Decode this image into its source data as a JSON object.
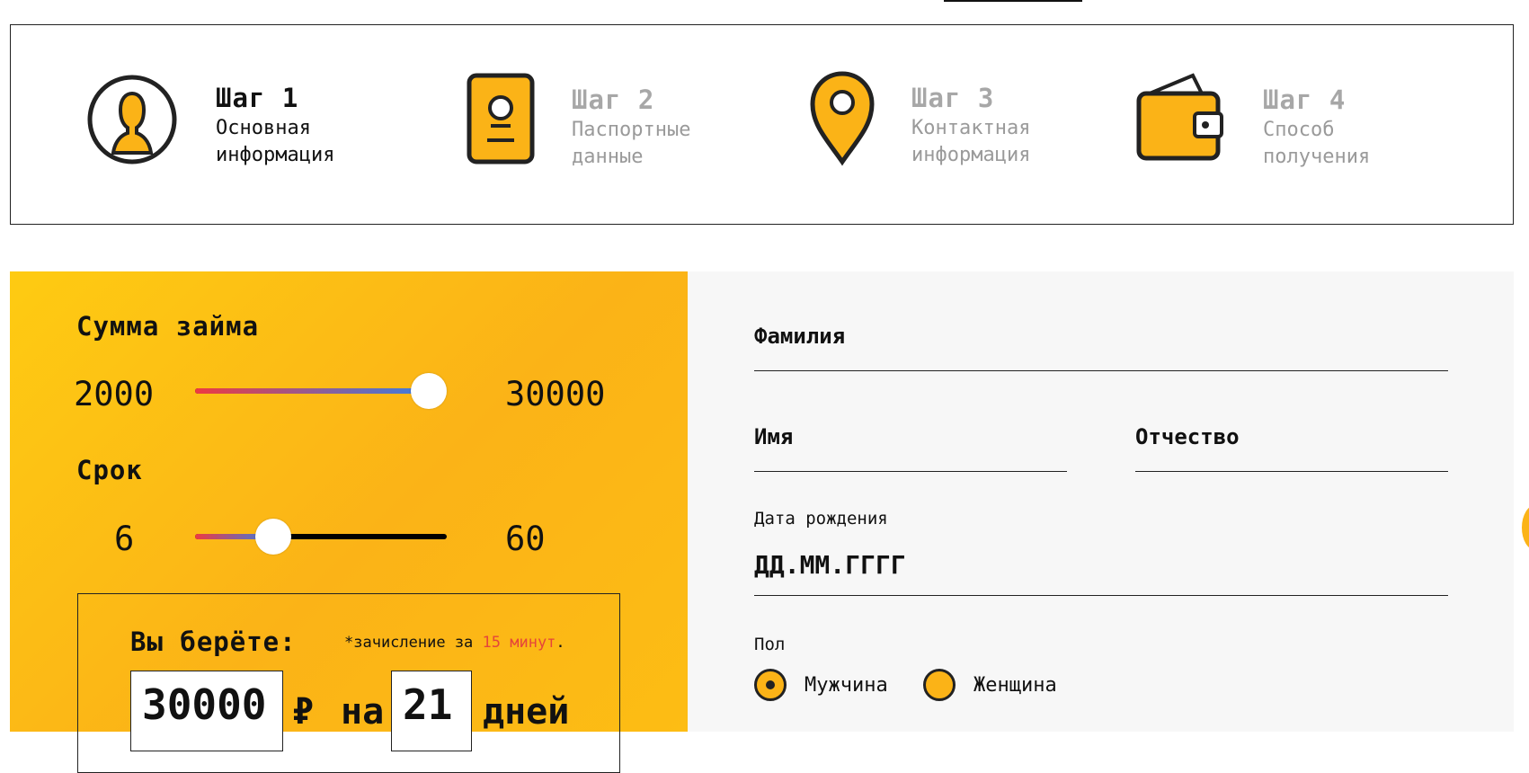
{
  "steps": [
    {
      "number": "Шаг 1",
      "line1": "Основная",
      "line2": "информация",
      "icon": "user-icon",
      "state": "active"
    },
    {
      "number": "Шаг 2",
      "line1": "Паспортные данные",
      "line2": "",
      "icon": "passport-icon",
      "state": "inactive"
    },
    {
      "number": "Шаг 3",
      "line1": "Контактная",
      "line2": "информация",
      "icon": "location-pin-icon",
      "state": "inactive"
    },
    {
      "number": "Шаг 4",
      "line1": "Способ получения",
      "line2": "",
      "icon": "wallet-icon",
      "state": "inactive"
    }
  ],
  "calculator": {
    "amount_title": "Сумма займа",
    "amount_min": "2000",
    "amount_max": "30000",
    "amount_level": 0.93,
    "term_title": "Срок",
    "term_min": "6",
    "term_max": "60",
    "term_level": 0.31,
    "summary_label": "Вы берёте:",
    "note_prefix": "*зачисление за ",
    "note_highlight": "15 минут",
    "note_suffix": ".",
    "amount_value": "30000",
    "currency": "₽",
    "on_word": "на",
    "days_value": "21",
    "days_word": "дней"
  },
  "form": {
    "surname_label": "Фамилия",
    "name_label": "Имя",
    "patronymic_label": "Отчество",
    "dob_label": "Дата рождения",
    "dob_placeholder": "ДД.ММ.ГГГГ",
    "gender_label": "Пол",
    "gender_male": "Мужчина",
    "gender_female": "Женщина",
    "gender_selected": "Мужчина"
  },
  "colors": {
    "accent_yellow": "#fbb317",
    "slider_start": "#ee3a41",
    "slider_end": "#3a7ee2",
    "note_highlight": "#e5453a"
  }
}
